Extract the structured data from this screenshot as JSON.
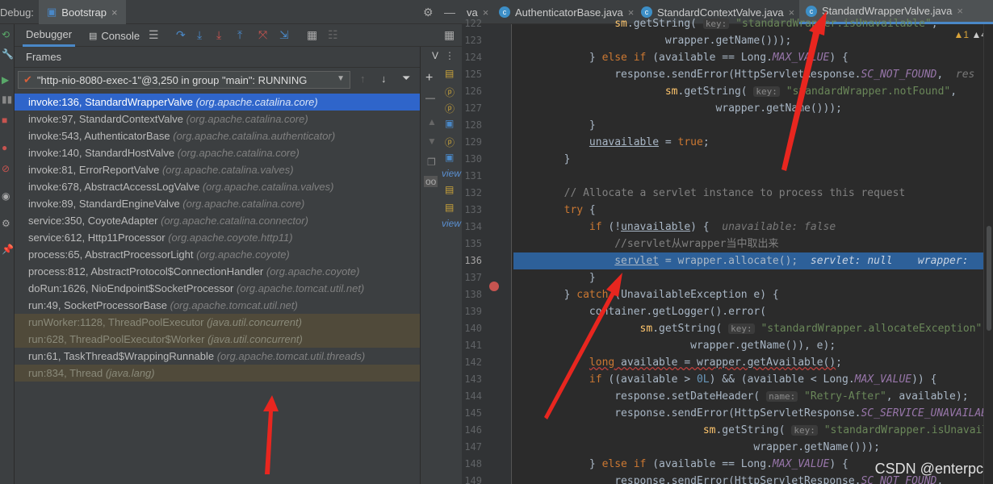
{
  "debug": {
    "label": "Debug:",
    "session": "Bootstrap",
    "close": "×"
  },
  "subtabs": {
    "debugger": "Debugger",
    "console": "Console"
  },
  "frames_header": "Frames",
  "vars_header": "V",
  "thread": "\"http-nio-8080-exec-1\"@3,250 in group \"main\": RUNNING",
  "frames": [
    {
      "m": "invoke:136, StandardWrapperValve",
      "p": "(org.apache.catalina.core)",
      "state": "selected"
    },
    {
      "m": "invoke:97, StandardContextValve",
      "p": "(org.apache.catalina.core)",
      "state": ""
    },
    {
      "m": "invoke:543, AuthenticatorBase",
      "p": "(org.apache.catalina.authenticator)",
      "state": ""
    },
    {
      "m": "invoke:140, StandardHostValve",
      "p": "(org.apache.catalina.core)",
      "state": ""
    },
    {
      "m": "invoke:81, ErrorReportValve",
      "p": "(org.apache.catalina.valves)",
      "state": ""
    },
    {
      "m": "invoke:678, AbstractAccessLogValve",
      "p": "(org.apache.catalina.valves)",
      "state": ""
    },
    {
      "m": "invoke:89, StandardEngineValve",
      "p": "(org.apache.catalina.core)",
      "state": ""
    },
    {
      "m": "service:350, CoyoteAdapter",
      "p": "(org.apache.catalina.connector)",
      "state": ""
    },
    {
      "m": "service:612, Http11Processor",
      "p": "(org.apache.coyote.http11)",
      "state": ""
    },
    {
      "m": "process:65, AbstractProcessorLight",
      "p": "(org.apache.coyote)",
      "state": ""
    },
    {
      "m": "process:812, AbstractProtocol$ConnectionHandler",
      "p": "(org.apache.coyote)",
      "state": ""
    },
    {
      "m": "doRun:1626, NioEndpoint$SocketProcessor",
      "p": "(org.apache.tomcat.util.net)",
      "state": ""
    },
    {
      "m": "run:49, SocketProcessorBase",
      "p": "(org.apache.tomcat.util.net)",
      "state": ""
    },
    {
      "m": "runWorker:1128, ThreadPoolExecutor",
      "p": "(java.util.concurrent)",
      "state": "library"
    },
    {
      "m": "run:628, ThreadPoolExecutor$Worker",
      "p": "(java.util.concurrent)",
      "state": "library"
    },
    {
      "m": "run:61, TaskThread$WrappingRunnable",
      "p": "(org.apache.tomcat.util.threads)",
      "state": ""
    },
    {
      "m": "run:834, Thread",
      "p": "(java.lang)",
      "state": "library"
    }
  ],
  "editor_tabs": [
    {
      "label": "va",
      "active": false
    },
    {
      "label": "AuthenticatorBase.java",
      "active": false
    },
    {
      "label": "StandardContextValve.java",
      "active": false
    },
    {
      "label": "StandardWrapperValve.java",
      "active": true
    }
  ],
  "line_numbers": [
    "122",
    "123",
    "124",
    "125",
    "126",
    "127",
    "128",
    "129",
    "130",
    "131",
    "132",
    "133",
    "134",
    "135",
    "136",
    "137",
    "138",
    "139",
    "140",
    "141",
    "142",
    "143",
    "144",
    "145",
    "146",
    "147",
    "148",
    "149"
  ],
  "current_line": "136",
  "inspections": {
    "warnings": "▲1",
    "weak": "▲4"
  },
  "watermark": "CSDN @enterpc",
  "vars_strip": [
    "view",
    "view"
  ]
}
